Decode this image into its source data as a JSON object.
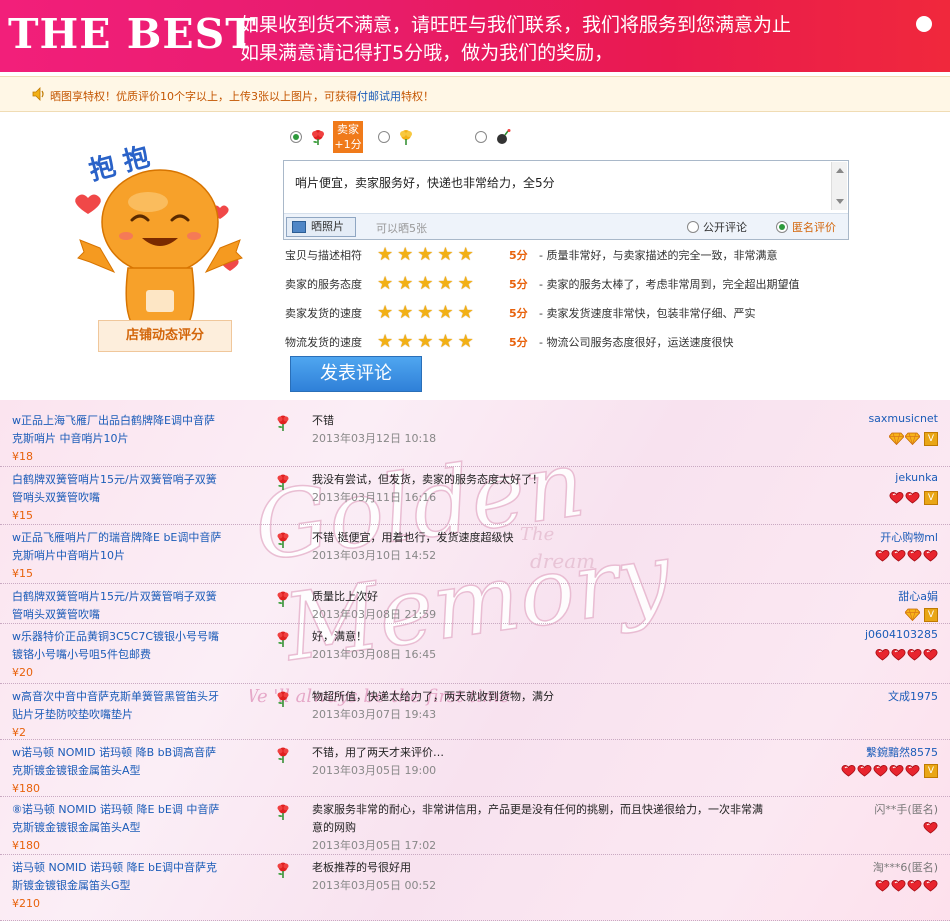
{
  "header": {
    "logo": "THE BEST",
    "line1": "如果收到货不满意，请旺旺与我们联系，我们将服务到您满意为止",
    "line2": "如果满意请记得打5分哦，做为我们的奖励，"
  },
  "notice": {
    "prefix": "晒图享特权！优质评价10个字以上，上传3张以上图片，可获得",
    "highlight": "付邮试用",
    "suffix": "特权！"
  },
  "form": {
    "seller_badge_line1": "卖家",
    "seller_badge_line2": "+1分",
    "comment_text": "哨片便宜，卖家服务好，快递也非常给力，全5分",
    "photo_button": "晒照片",
    "photo_hint": "可以晒5张",
    "public_label": "公开评论",
    "anonymous_label": "匿名评价",
    "shop_rating_label": "店铺动态评分",
    "submit_label": "发表评论",
    "mascot_text": "抱 抱",
    "scores": [
      {
        "label": "宝贝与描述相符",
        "points": "5分",
        "desc": "- 质量非常好，与卖家描述的完全一致，非常满意",
        "stars": 5
      },
      {
        "label": "卖家的服务态度",
        "points": "5分",
        "desc": "- 卖家的服务太棒了，考虑非常周到，完全超出期望值",
        "stars": 5
      },
      {
        "label": "卖家发货的速度",
        "points": "5分",
        "desc": "- 卖家发货速度非常快，包装非常仔细、严实",
        "stars": 5
      },
      {
        "label": "物流发货的速度",
        "points": "5分",
        "desc": "- 物流公司服务态度很好，运送速度很快",
        "stars": 5
      }
    ]
  },
  "watermark": {
    "word1": "Golden",
    "word2": "Memory",
    "small1": "The",
    "small2": "dream",
    "tagline": "We 'll always be the first time"
  },
  "reviews": [
    {
      "title": "w正品上海飞雁厂出品白鹤牌降E调中音萨克斯哨片 中音哨片10片",
      "price": "¥18",
      "comment": "不错",
      "date": "2013年03月12日 10:18",
      "user": "saxmusicnet",
      "hearts": 0,
      "gems": 2,
      "level": true
    },
    {
      "title": "白鹤牌双簧管哨片15元/片双簧管哨子双簧管哨头双簧管吹嘴",
      "price": "¥15",
      "comment": "我没有尝试，但发货，卖家的服务态度太好了！",
      "date": "2013年03月11日 16:16",
      "user": "jekunka",
      "hearts": 2,
      "gems": 0,
      "level": true
    },
    {
      "title": "w正品飞雁哨片厂的瑞音牌降E bE调中音萨克斯哨片中音哨片10片",
      "price": "¥15",
      "comment": "不错 挺便宜，用着也行，发货速度超级快",
      "date": "2013年03月10日 14:52",
      "user": "开心购物ml",
      "hearts": 4,
      "gems": 0,
      "level": false
    },
    {
      "title": "白鹤牌双簧管哨片15元/片双簧管哨子双簧管哨头双簧管吹嘴",
      "price": "",
      "comment": "质量比上次好",
      "date": "2013年03月08日 21:59",
      "user": "甜心a娟",
      "hearts": 0,
      "gems": 1,
      "level": true
    },
    {
      "title": "w乐器特价正品黄铜3C5C7C镀银小号号嘴镀铬小号嘴小号咀5件包邮费",
      "price": "¥20",
      "comment": "好，满意！",
      "date": "2013年03月08日 16:45",
      "user": "j0604103285",
      "hearts": 4,
      "gems": 0,
      "level": false
    },
    {
      "title": "w高音次中音中音萨克斯单簧管黑管笛头牙贴片牙垫防咬垫吹嘴垫片",
      "price": "¥2",
      "comment": "物超所值，快递太给力了，两天就收到货物，满分",
      "date": "2013年03月07日 19:43",
      "user": "文成1975",
      "hearts": 0,
      "gems": 0,
      "level": false
    },
    {
      "title": "w诺马顿 NOMID 诺玛顿 降B bB调高音萨克斯镀金镀银金属笛头A型",
      "price": "¥180",
      "comment": "不错，用了两天才来评价…",
      "date": "2013年03月05日 19:00",
      "user": "繫鋺黯然8575",
      "hearts": 5,
      "gems": 0,
      "level": true
    },
    {
      "title": "⑧诺马顿 NOMID 诺玛顿 降E bE调 中音萨克斯镀金镀银金属笛头A型",
      "price": "¥180",
      "comment": "卖家服务非常的耐心，非常讲信用，产品更是没有任何的挑剔，而且快递很给力，一次非常满意的网购",
      "date": "2013年03月05日 17:02",
      "user": "闪**手(匿名)",
      "hearts": 1,
      "gems": 0,
      "level": false,
      "anonymous": true
    },
    {
      "title": "诺马顿 NOMID 诺玛顿 降E bE调中音萨克斯镀金镀银金属笛头G型",
      "price": "¥210",
      "comment": "老板推荐的号很好用",
      "date": "2013年03月05日 00:52",
      "user": "淘***6(匿名)",
      "hearts": 4,
      "gems": 0,
      "level": false,
      "anonymous": true
    }
  ]
}
